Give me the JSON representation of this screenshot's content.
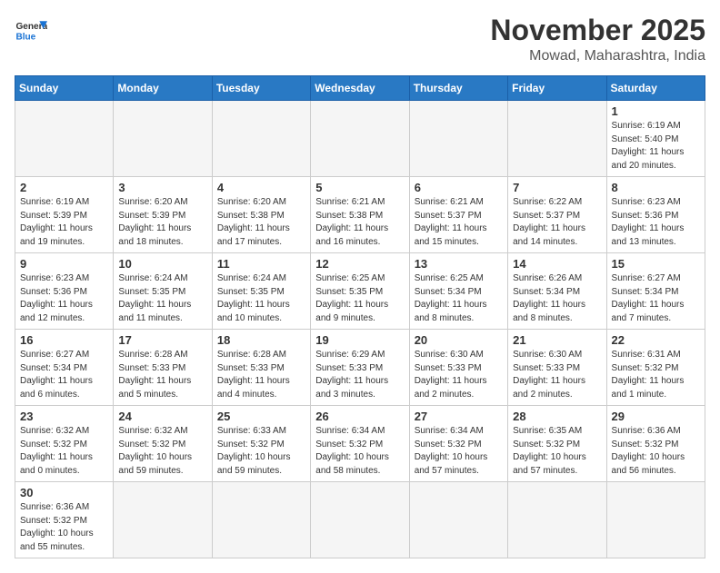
{
  "header": {
    "logo_general": "General",
    "logo_blue": "Blue",
    "month_title": "November 2025",
    "location": "Mowad, Maharashtra, India"
  },
  "weekdays": [
    "Sunday",
    "Monday",
    "Tuesday",
    "Wednesday",
    "Thursday",
    "Friday",
    "Saturday"
  ],
  "weeks": [
    [
      {
        "day": "",
        "info": ""
      },
      {
        "day": "",
        "info": ""
      },
      {
        "day": "",
        "info": ""
      },
      {
        "day": "",
        "info": ""
      },
      {
        "day": "",
        "info": ""
      },
      {
        "day": "",
        "info": ""
      },
      {
        "day": "1",
        "info": "Sunrise: 6:19 AM\nSunset: 5:40 PM\nDaylight: 11 hours\nand 20 minutes."
      }
    ],
    [
      {
        "day": "2",
        "info": "Sunrise: 6:19 AM\nSunset: 5:39 PM\nDaylight: 11 hours\nand 19 minutes."
      },
      {
        "day": "3",
        "info": "Sunrise: 6:20 AM\nSunset: 5:39 PM\nDaylight: 11 hours\nand 18 minutes."
      },
      {
        "day": "4",
        "info": "Sunrise: 6:20 AM\nSunset: 5:38 PM\nDaylight: 11 hours\nand 17 minutes."
      },
      {
        "day": "5",
        "info": "Sunrise: 6:21 AM\nSunset: 5:38 PM\nDaylight: 11 hours\nand 16 minutes."
      },
      {
        "day": "6",
        "info": "Sunrise: 6:21 AM\nSunset: 5:37 PM\nDaylight: 11 hours\nand 15 minutes."
      },
      {
        "day": "7",
        "info": "Sunrise: 6:22 AM\nSunset: 5:37 PM\nDaylight: 11 hours\nand 14 minutes."
      },
      {
        "day": "8",
        "info": "Sunrise: 6:23 AM\nSunset: 5:36 PM\nDaylight: 11 hours\nand 13 minutes."
      }
    ],
    [
      {
        "day": "9",
        "info": "Sunrise: 6:23 AM\nSunset: 5:36 PM\nDaylight: 11 hours\nand 12 minutes."
      },
      {
        "day": "10",
        "info": "Sunrise: 6:24 AM\nSunset: 5:35 PM\nDaylight: 11 hours\nand 11 minutes."
      },
      {
        "day": "11",
        "info": "Sunrise: 6:24 AM\nSunset: 5:35 PM\nDaylight: 11 hours\nand 10 minutes."
      },
      {
        "day": "12",
        "info": "Sunrise: 6:25 AM\nSunset: 5:35 PM\nDaylight: 11 hours\nand 9 minutes."
      },
      {
        "day": "13",
        "info": "Sunrise: 6:25 AM\nSunset: 5:34 PM\nDaylight: 11 hours\nand 8 minutes."
      },
      {
        "day": "14",
        "info": "Sunrise: 6:26 AM\nSunset: 5:34 PM\nDaylight: 11 hours\nand 8 minutes."
      },
      {
        "day": "15",
        "info": "Sunrise: 6:27 AM\nSunset: 5:34 PM\nDaylight: 11 hours\nand 7 minutes."
      }
    ],
    [
      {
        "day": "16",
        "info": "Sunrise: 6:27 AM\nSunset: 5:34 PM\nDaylight: 11 hours\nand 6 minutes."
      },
      {
        "day": "17",
        "info": "Sunrise: 6:28 AM\nSunset: 5:33 PM\nDaylight: 11 hours\nand 5 minutes."
      },
      {
        "day": "18",
        "info": "Sunrise: 6:28 AM\nSunset: 5:33 PM\nDaylight: 11 hours\nand 4 minutes."
      },
      {
        "day": "19",
        "info": "Sunrise: 6:29 AM\nSunset: 5:33 PM\nDaylight: 11 hours\nand 3 minutes."
      },
      {
        "day": "20",
        "info": "Sunrise: 6:30 AM\nSunset: 5:33 PM\nDaylight: 11 hours\nand 2 minutes."
      },
      {
        "day": "21",
        "info": "Sunrise: 6:30 AM\nSunset: 5:33 PM\nDaylight: 11 hours\nand 2 minutes."
      },
      {
        "day": "22",
        "info": "Sunrise: 6:31 AM\nSunset: 5:32 PM\nDaylight: 11 hours\nand 1 minute."
      }
    ],
    [
      {
        "day": "23",
        "info": "Sunrise: 6:32 AM\nSunset: 5:32 PM\nDaylight: 11 hours\nand 0 minutes."
      },
      {
        "day": "24",
        "info": "Sunrise: 6:32 AM\nSunset: 5:32 PM\nDaylight: 10 hours\nand 59 minutes."
      },
      {
        "day": "25",
        "info": "Sunrise: 6:33 AM\nSunset: 5:32 PM\nDaylight: 10 hours\nand 59 minutes."
      },
      {
        "day": "26",
        "info": "Sunrise: 6:34 AM\nSunset: 5:32 PM\nDaylight: 10 hours\nand 58 minutes."
      },
      {
        "day": "27",
        "info": "Sunrise: 6:34 AM\nSunset: 5:32 PM\nDaylight: 10 hours\nand 57 minutes."
      },
      {
        "day": "28",
        "info": "Sunrise: 6:35 AM\nSunset: 5:32 PM\nDaylight: 10 hours\nand 57 minutes."
      },
      {
        "day": "29",
        "info": "Sunrise: 6:36 AM\nSunset: 5:32 PM\nDaylight: 10 hours\nand 56 minutes."
      }
    ],
    [
      {
        "day": "30",
        "info": "Sunrise: 6:36 AM\nSunset: 5:32 PM\nDaylight: 10 hours\nand 55 minutes."
      },
      {
        "day": "",
        "info": ""
      },
      {
        "day": "",
        "info": ""
      },
      {
        "day": "",
        "info": ""
      },
      {
        "day": "",
        "info": ""
      },
      {
        "day": "",
        "info": ""
      },
      {
        "day": "",
        "info": ""
      }
    ]
  ]
}
